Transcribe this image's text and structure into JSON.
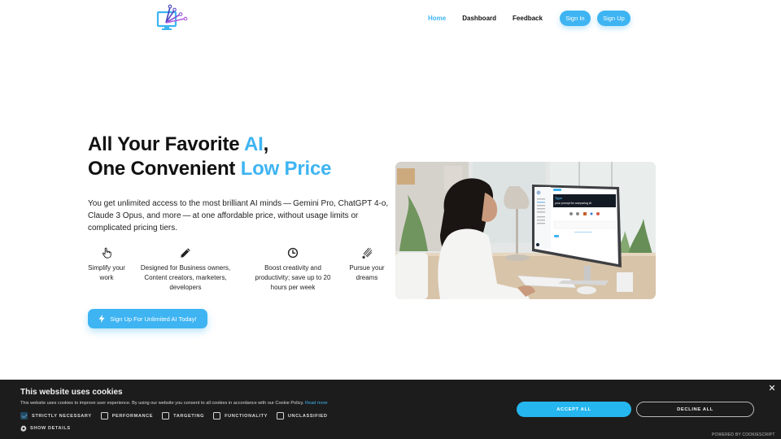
{
  "header": {
    "logo_alt": "AI monitor logo",
    "nav": [
      {
        "label": "Home",
        "active": true
      },
      {
        "label": "Dashboard",
        "active": false
      },
      {
        "label": "Feedback",
        "active": false
      }
    ],
    "sign_in_label": "Sign In",
    "sign_up_label": "Sign Up"
  },
  "hero": {
    "title_line1_prefix": "All Your Favorite ",
    "title_line1_accent": "AI",
    "title_line1_suffix": ",",
    "title_line2_prefix": "One Convenient ",
    "title_line2_accent": "Low Price",
    "description": "You get unlimited access to the most brilliant AI minds — Gemini Pro, ChatGPT 4-o, Claude 3 Opus, and more — at one affordable price, without usage limits or complicated pricing tiers.",
    "features": [
      {
        "icon": "pointer-hand-icon",
        "text": "Simplify your work"
      },
      {
        "icon": "pencil-icon",
        "text": "Designed for Business owners, Content creators, marketers, developers"
      },
      {
        "icon": "clock-icon",
        "text": "Boost creativity and productivity; save up to 20 hours per week"
      },
      {
        "icon": "shooting-star-icon",
        "text": "Pursue your dreams"
      }
    ],
    "cta_label": "Sign Up For Unlimited AI Today!",
    "cta_icon": "bolt-icon",
    "image": {
      "description": "Woman at desk using a curved monitor showing an AI comparison app",
      "screen_heading_line1": "Type",
      "screen_heading_line2": "your prompt for comparing AI"
    }
  },
  "cookie_banner": {
    "title": "This website uses cookies",
    "text": "This website uses cookies to improve user experience. By using our website you consent to all cookies in accordance with our Cookie Policy.",
    "read_more": "Read more",
    "categories": [
      {
        "label": "STRICTLY NECESSARY",
        "checked": true
      },
      {
        "label": "PERFORMANCE",
        "checked": false
      },
      {
        "label": "TARGETING",
        "checked": false
      },
      {
        "label": "FUNCTIONALITY",
        "checked": false
      },
      {
        "label": "UNCLASSIFIED",
        "checked": false
      }
    ],
    "show_details": "SHOW DETAILS",
    "accept_all": "ACCEPT ALL",
    "decline_all": "DECLINE ALL",
    "close_symbol": "✕",
    "powered_by": "POWERED BY COOKIESCRIPT"
  },
  "colors": {
    "accent": "#3eb4f2",
    "cookie_bg": "#1c1c1c",
    "accept_button": "#25b6ef"
  }
}
